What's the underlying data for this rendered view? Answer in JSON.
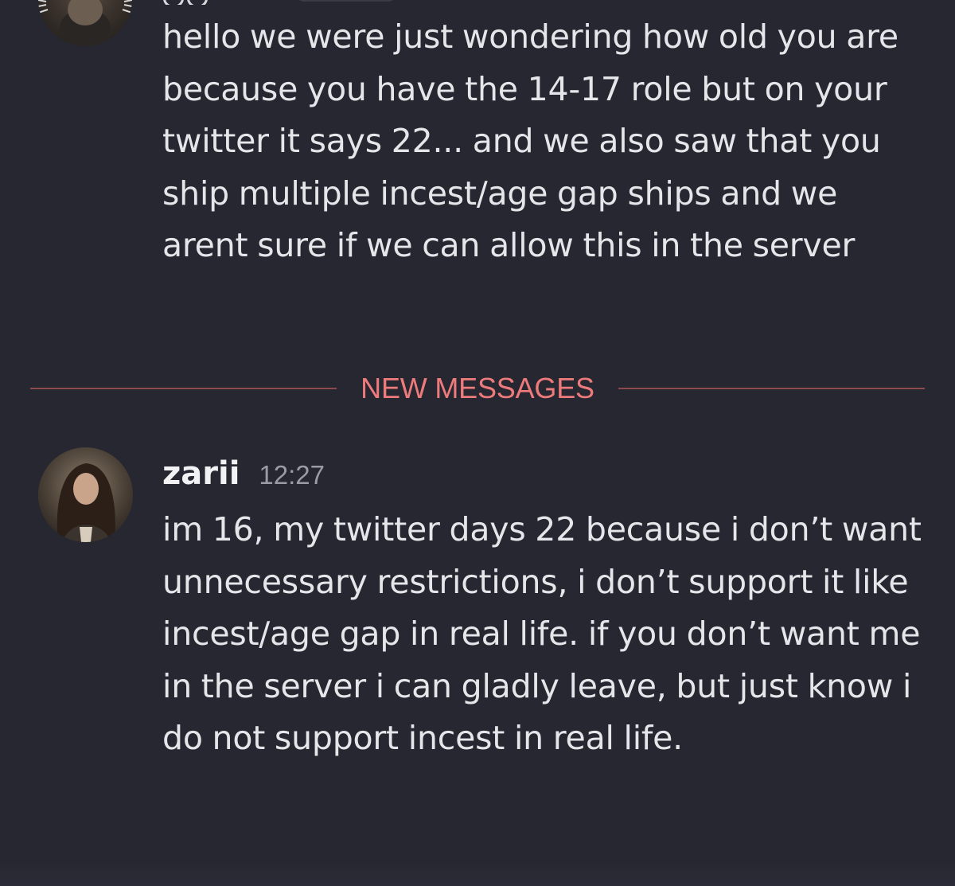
{
  "previous_message": {
    "text": "hello we were just wondering how old you are because you have the 14-17 role but on your twitter it says 22... and we also saw that you ship multiple incest/age gap ships and we arent sure if we can allow this in the server"
  },
  "divider": {
    "label": "NEW MESSAGES"
  },
  "message": {
    "author": "zarii",
    "timestamp": "12:27",
    "text": "im 16, my twitter days 22 because i don’t want unnecessary restrictions, i don’t support it like incest/age gap in real life. if you don’t want me in the server i can gladly leave, but just know i do not support incest in real life."
  },
  "colors": {
    "background": "#262731",
    "text": "#e6e6ea",
    "divider_label": "#ee7b7b",
    "divider_line": "#8a4a4e",
    "timestamp": "#9a9ba6"
  }
}
